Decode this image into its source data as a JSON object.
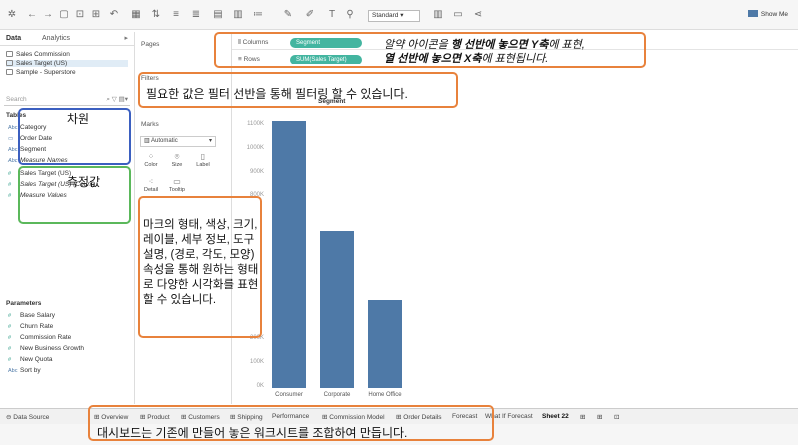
{
  "toolbar": {
    "fit_select": "Standard",
    "show_me": "Show Me"
  },
  "data_pane": {
    "tab_data": "Data",
    "tab_analytics": "Analytics",
    "datasources": [
      "Sales Commission",
      "Sales Target (US)",
      "Sample - Superstore"
    ],
    "search_placeholder": "Search",
    "tables_heading": "Tables",
    "dimensions": [
      {
        "type": "Abc",
        "label": "Category"
      },
      {
        "type": "▭",
        "label": "Order Date"
      },
      {
        "type": "Abc",
        "label": "Segment"
      },
      {
        "type": "Abc",
        "label": "Measure Names"
      }
    ],
    "measures": [
      {
        "type": "#",
        "label": "Sales Target (US)"
      },
      {
        "type": "#",
        "label": "Sales Target (US) (Count)"
      },
      {
        "type": "#",
        "label": "Measure Values"
      }
    ],
    "parameters_heading": "Parameters",
    "parameters": [
      {
        "type": "#",
        "label": "Base Salary"
      },
      {
        "type": "#",
        "label": "Churn Rate"
      },
      {
        "type": "#",
        "label": "Commission Rate"
      },
      {
        "type": "#",
        "label": "New Business Growth"
      },
      {
        "type": "#",
        "label": "New Quota"
      },
      {
        "type": "Abc",
        "label": "Sort by"
      }
    ]
  },
  "cards": {
    "pages": "Pages",
    "filters": "Filters",
    "marks": "Marks",
    "mark_type": "Automatic",
    "mark_buttons": [
      "Color",
      "Size",
      "Label",
      "Detail",
      "Tooltip"
    ]
  },
  "shelves": {
    "columns_label": "Columns",
    "columns_pill": "Segment",
    "rows_label": "Rows",
    "rows_pill": "SUM(Sales Target)"
  },
  "chart_data": {
    "type": "bar",
    "title": "Segment",
    "categories": [
      "Consumer",
      "Corporate",
      "Home Office"
    ],
    "values": [
      1120000,
      660000,
      370000
    ],
    "ylim": [
      0,
      1100000
    ],
    "y_ticks": [
      "1100K",
      "1000K",
      "900K",
      "800K",
      "200K",
      "100K",
      "0K"
    ],
    "grid": false,
    "color": "#4e79a7"
  },
  "sheet_tabs": {
    "data_source": "Data Source",
    "tabs": [
      "Overview",
      "Product",
      "Customers",
      "Shipping",
      "Performance",
      "Commission Model",
      "Order Details",
      "Forecast",
      "What If Forecast",
      "Sheet 22"
    ],
    "active": "Sheet 22"
  },
  "annotations": {
    "rows_line1_pre": "알약 아이콘을 ",
    "rows_line1_bold": "행 선반에 놓으면 Y축",
    "rows_line1_post": "에 표현,",
    "rows_line2_bold": "열 선반에 놓으면 X축",
    "rows_line2_post": "에 표현됩니다.",
    "filters": "필요한 값은 필터 선반을 통해 필터링 할 수 있습니다.",
    "marks": "마크의 형태, 색상, 크기, 레이블, 세부 정보, 도구 설명, (경로, 각도, 모양) 속성을 통해 원하는 형태로 다양한 시각화를 표현할 수 있습니다.",
    "dimensions": "차원",
    "measures": "측정값",
    "dashboard": "대시보드는 기존에 만들어 놓은 워크시트를 조합하여 만듭니다."
  },
  "colors": {
    "callout": "#e8823c",
    "dimension_box": "#3b5fc0",
    "measure_box": "#5bb85b",
    "pill": "#43b5a0",
    "bar": "#4e79a7"
  }
}
